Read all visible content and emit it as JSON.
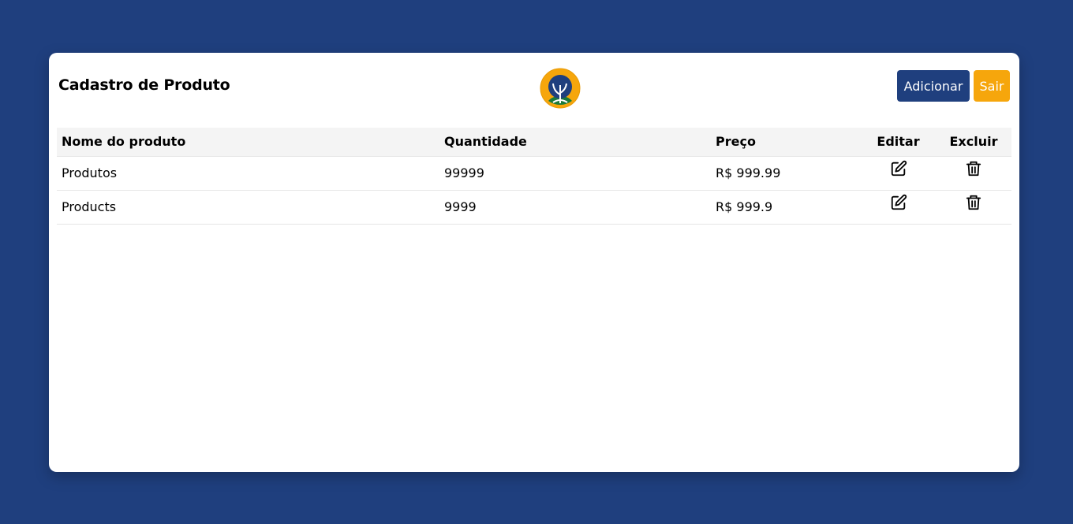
{
  "header": {
    "title": "Cadastro de Produto",
    "logo_icon": "tree-circle-logo-icon",
    "add_label": "Adicionar",
    "exit_label": "Sair"
  },
  "table": {
    "columns": [
      "Nome do produto",
      "Quantidade",
      "Preço",
      "Editar",
      "Excluir"
    ],
    "rows": [
      {
        "name": "Produtos",
        "quantity": "99999",
        "price": "R$ 999.99"
      },
      {
        "name": "Products",
        "quantity": "9999",
        "price": "R$ 999.9"
      }
    ],
    "edit_icon": "edit-pencil-icon",
    "delete_icon": "trash-icon"
  },
  "colors": {
    "background": "#1f3f7e",
    "primary": "#1f3f7e",
    "accent": "#f6a60c",
    "logo_green": "#1a7a3a"
  }
}
